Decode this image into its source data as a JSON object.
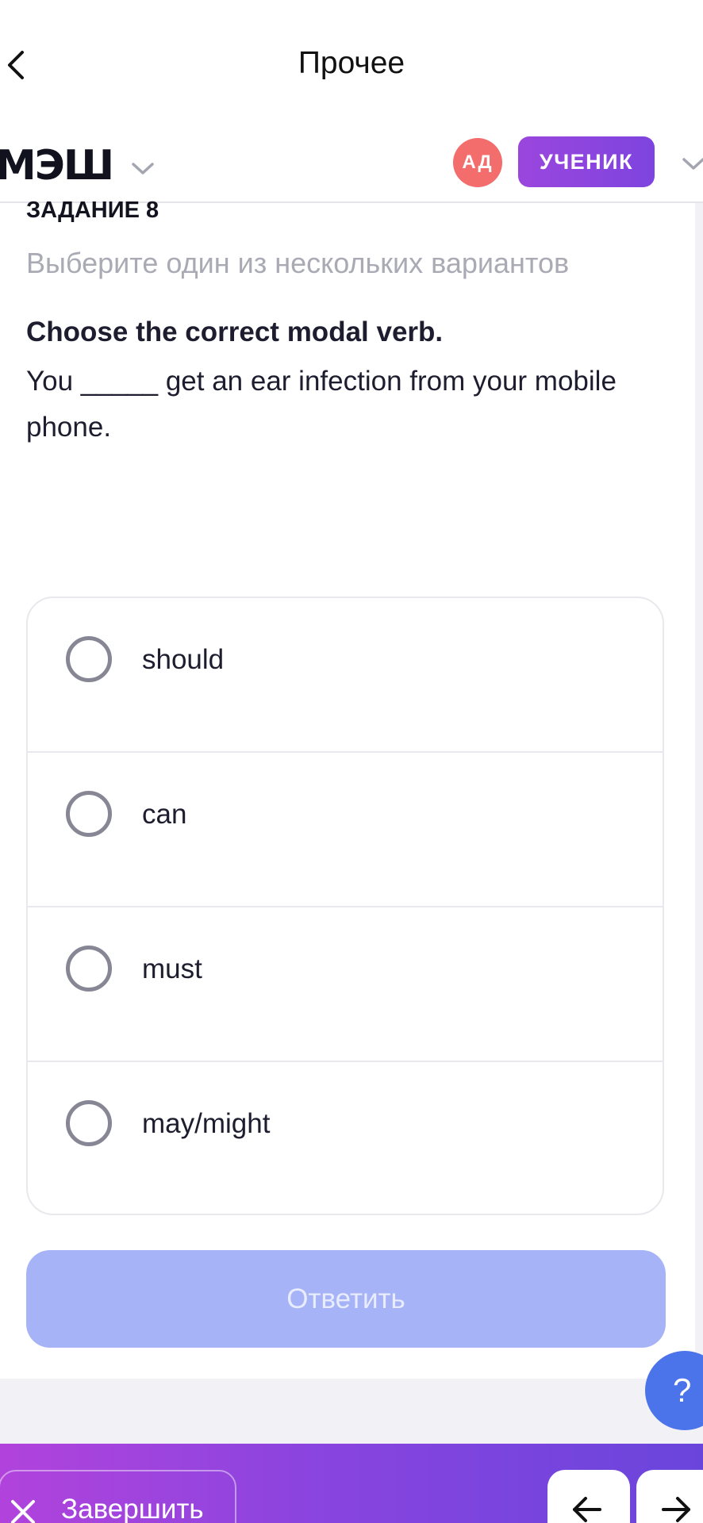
{
  "nav": {
    "title": "Прочее"
  },
  "header": {
    "logo": "МЭШ",
    "avatar_initials": "АД",
    "role_badge": "УЧЕНИК"
  },
  "task": {
    "number_label": "ЗАДАНИЕ 8",
    "instruction": "Выберите один из нескольких вариантов",
    "question_title": "Choose the correct modal verb.",
    "question_text": "You _____ get an ear infection from your mobile phone.",
    "options": [
      {
        "label": "should",
        "selected": false
      },
      {
        "label": "can",
        "selected": false
      },
      {
        "label": "must",
        "selected": false
      },
      {
        "label": "may/might",
        "selected": false
      }
    ],
    "submit_label": "Ответить"
  },
  "help": {
    "label": "?"
  },
  "bottom_bar": {
    "finish_label": "Завершить"
  },
  "icons": {
    "back": "chevron-left-icon",
    "logo_dropdown": "chevron-down-icon",
    "profile_dropdown": "chevron-down-icon",
    "finish": "close-icon",
    "prev": "arrow-left-icon",
    "next": "arrow-right-icon"
  },
  "colors": {
    "accent_purple": "#8a44df",
    "avatar": "#f36d6d",
    "submit_disabled": "#a6b4f7",
    "help_button": "#4c74ea"
  }
}
